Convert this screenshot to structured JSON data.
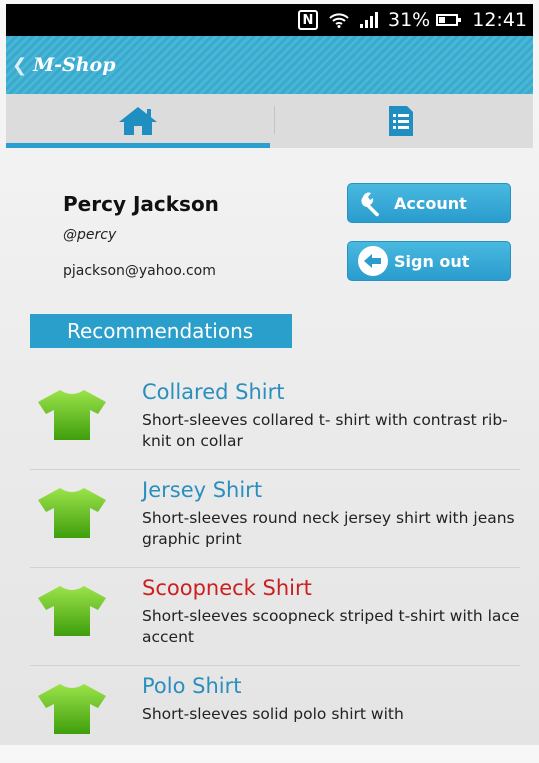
{
  "status_bar": {
    "nfc": "N",
    "battery_percent": "31%",
    "battery_level": 0.31,
    "time": "12:41"
  },
  "action_bar": {
    "title": "M-Shop",
    "back_icon": "chevron-left-icon"
  },
  "tabs": [
    {
      "icon": "home-icon",
      "active": true
    },
    {
      "icon": "document-list-icon",
      "active": false
    }
  ],
  "profile": {
    "name": "Percy Jackson",
    "handle": "@percy",
    "email": "pjackson@yahoo.com"
  },
  "buttons": {
    "account_label": "Account",
    "signout_label": "Sign out"
  },
  "recommendations": {
    "header": "Recommendations",
    "items": [
      {
        "title": "Collared Shirt",
        "description": "Short-sleeves collared t- shirt with contrast rib-knit on collar",
        "title_color": "#2a8fbd"
      },
      {
        "title": "Jersey Shirt",
        "description": "Short-sleeves round neck jersey shirt with jeans graphic print",
        "title_color": "#2a8fbd"
      },
      {
        "title": "Scoopneck Shirt",
        "description": "Short-sleeves scoopneck striped t-shirt with lace accent",
        "title_color": "#cc1f1f"
      },
      {
        "title": "Polo Shirt",
        "description": "Short-sleeves solid polo shirt with",
        "title_color": "#2a8fbd"
      }
    ]
  },
  "colors": {
    "accent": "#2a9fcb",
    "shirt_green": "#6cc51b"
  }
}
